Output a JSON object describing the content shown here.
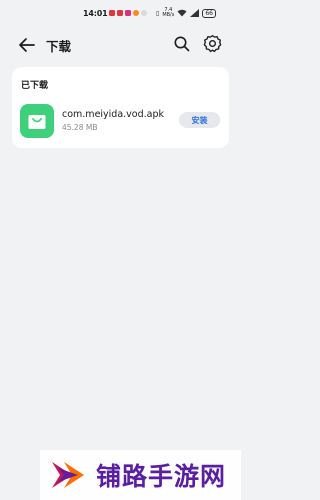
{
  "status_bar": {
    "time": "14:01",
    "net_speed_value": "7.4",
    "net_speed_unit": "MB/s",
    "battery": "66"
  },
  "header": {
    "title": "下载",
    "back_icon": "arrow-left-icon",
    "search_icon": "search-icon",
    "settings_icon": "gear-icon"
  },
  "downloads": {
    "section_title": "已下载",
    "items": [
      {
        "name": "com.meiyida.vod.apk",
        "size": "45.28 MB",
        "action_label": "安装",
        "icon": "shopping-bag-icon",
        "icon_color": "#3fd07c"
      }
    ]
  },
  "watermark": {
    "text": "铺路手游网"
  },
  "colors": {
    "background": "#f1f2f4",
    "accent": "#2f6fe0",
    "watermark": "#5a1fa0"
  }
}
